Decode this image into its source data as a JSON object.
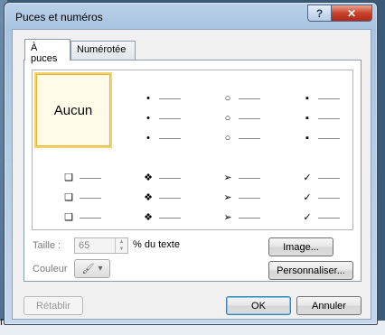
{
  "dialog": {
    "title": "Puces et numéros",
    "help_label": "?",
    "close_label": "✕"
  },
  "tabs": [
    {
      "label": "À puces",
      "active": true
    },
    {
      "label": "Numérotée",
      "active": false
    }
  ],
  "gallery": {
    "none_label": "Aucun",
    "bullets": {
      "dot": "•",
      "circle": "○",
      "square": "▪",
      "hollow_square": "❑",
      "diamonds": "❖",
      "arrow": "➢",
      "check": "✓"
    }
  },
  "options": {
    "size_label": "Taille :",
    "size_value": "65",
    "size_unit": "% du texte",
    "color_label": "Couleur",
    "color_icon": "🖌",
    "dropdown_arrow": "▾"
  },
  "buttons": {
    "image": "Image...",
    "customize": "Personnaliser...",
    "reset": "Rétablir",
    "ok": "OK",
    "cancel": "Annuler"
  },
  "background": {
    "partial_letter": "n"
  },
  "colors": {
    "selection_border": "#f4d36a",
    "title_bar": "#b9d1ea",
    "close_button": "#c8432a"
  }
}
